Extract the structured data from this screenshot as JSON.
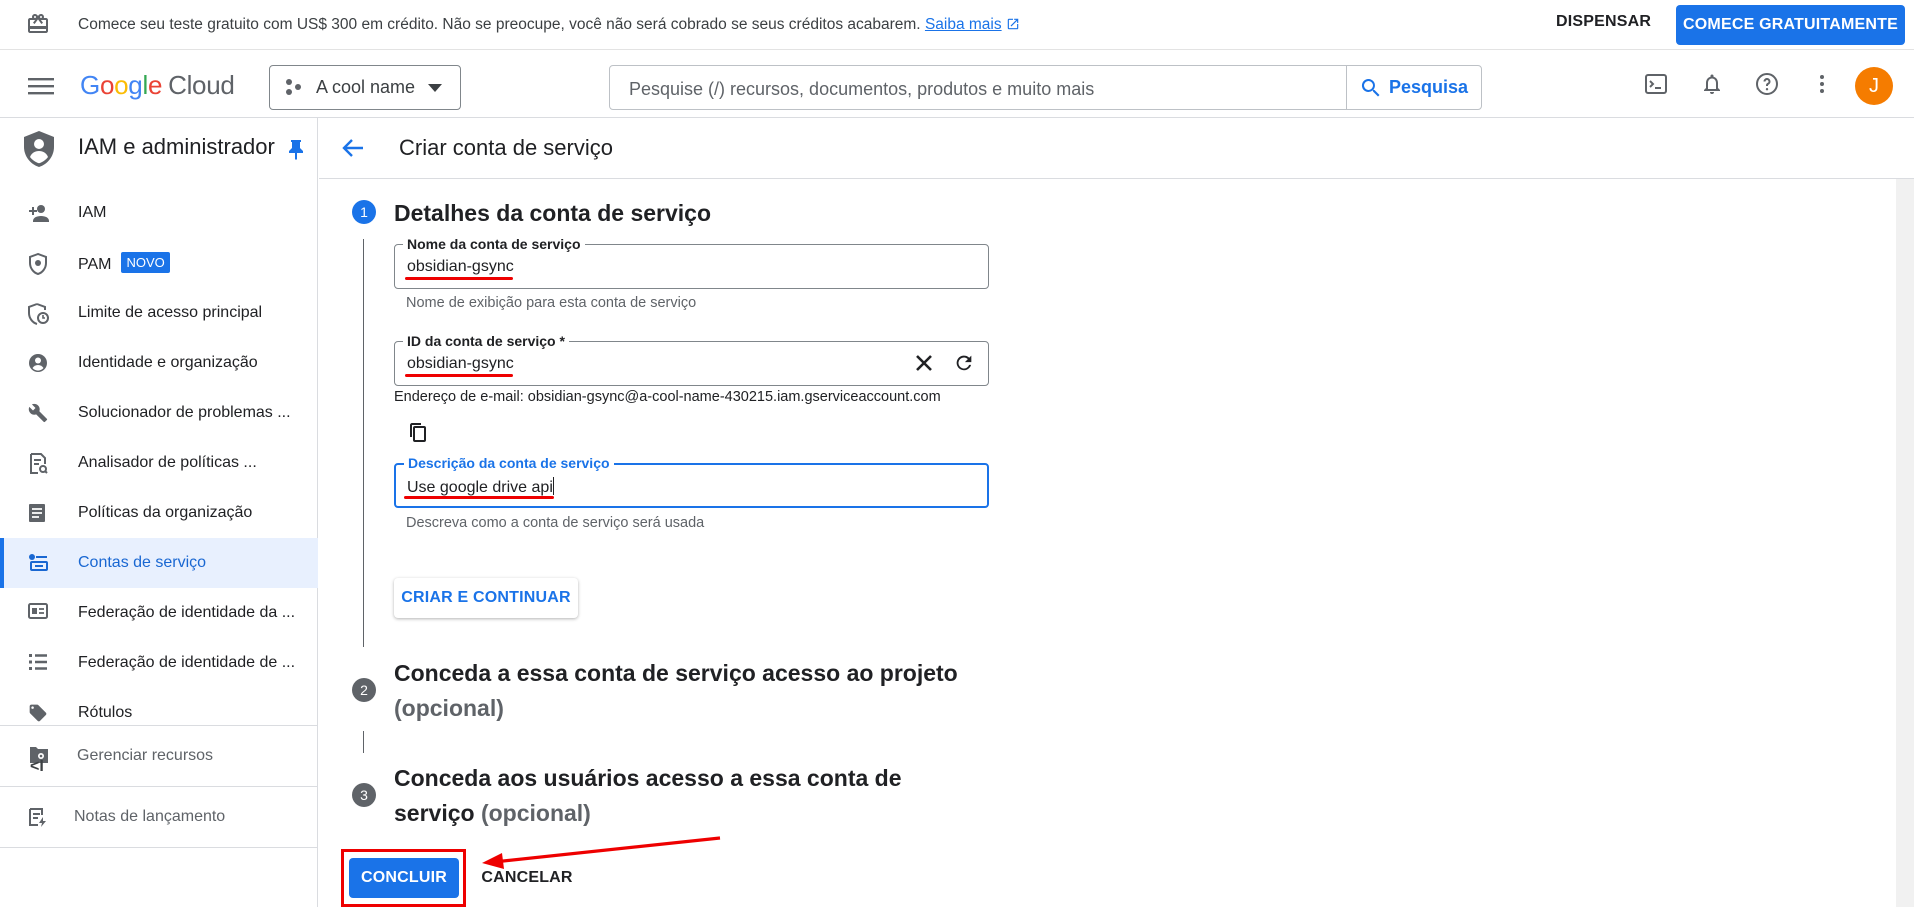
{
  "banner": {
    "message": "Comece seu teste gratuito com US$ 300 em crédito. Não se preocupe, você não será cobrado se seus créditos acabarem.",
    "learn_more": "Saiba mais",
    "dismiss": "DISPENSAR",
    "start_free": "COMECE GRATUITAMENTE"
  },
  "header": {
    "logo_google": "Google",
    "logo_cloud": "Cloud",
    "project_name": "A cool name",
    "search_placeholder": "Pesquise (/) recursos, documentos, produtos e muito mais",
    "search_button": "Pesquisa",
    "avatar_initial": "J"
  },
  "sidebar": {
    "title": "IAM e administrador",
    "items": [
      {
        "label": "IAM",
        "icon": "person-add-icon"
      },
      {
        "label": "PAM",
        "icon": "shield-lock-icon",
        "badge": "NOVO"
      },
      {
        "label": "Limite de acesso principal",
        "icon": "shield-time-icon"
      },
      {
        "label": "Identidade e organização",
        "icon": "account-circle-icon"
      },
      {
        "label": "Solucionador de problemas ...",
        "icon": "wrench-icon"
      },
      {
        "label": "Analisador de políticas ...",
        "icon": "policy-analyzer-icon"
      },
      {
        "label": "Políticas da organização",
        "icon": "document-icon"
      },
      {
        "label": "Contas de serviço",
        "icon": "service-account-icon",
        "active": true
      },
      {
        "label": "Federação de identidade da ...",
        "icon": "id-card-icon"
      },
      {
        "label": "Federação de identidade de ...",
        "icon": "list-icon"
      },
      {
        "label": "Rótulos",
        "icon": "tag-icon"
      }
    ],
    "manage_resources": "Gerenciar recursos",
    "release_notes": "Notas de lançamento",
    "collapse": "<I"
  },
  "page": {
    "title": "Criar conta de serviço",
    "step1": {
      "number": "1",
      "title": "Detalhes da conta de serviço",
      "name_label": "Nome da conta de serviço",
      "name_value": "obsidian-gsync",
      "name_hint": "Nome de exibição para esta conta de serviço",
      "id_label": "ID da conta de serviço *",
      "id_value": "obsidian-gsync",
      "email": "Endereço de e-mail: obsidian-gsync@a-cool-name-430215.iam.gserviceaccount.com",
      "desc_label": "Descrição da conta de serviço",
      "desc_value": "Use google drive api",
      "desc_hint": "Descreva como a conta de serviço será usada",
      "create_button": "CRIAR E CONTINUAR"
    },
    "step2": {
      "number": "2",
      "title": "Conceda a essa conta de serviço acesso ao projeto",
      "optional": "(opcional)"
    },
    "step3": {
      "number": "3",
      "title_line1": "Conceda aos usuários acesso a essa conta de",
      "title_line2": "serviço",
      "optional": "(opcional)"
    },
    "done_button": "CONCLUIR",
    "cancel_button": "CANCELAR"
  },
  "colors": {
    "primary": "#1a73e8",
    "annotation_red": "#e00000",
    "avatar": "#f57c00"
  }
}
